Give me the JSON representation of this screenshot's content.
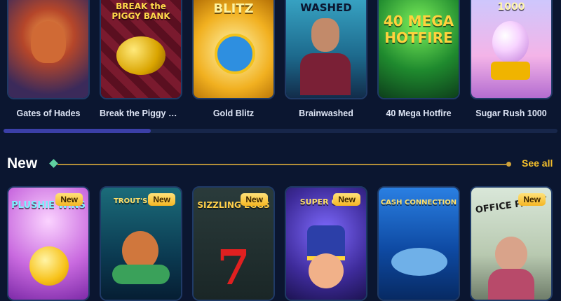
{
  "top_row": {
    "games": [
      {
        "label": "Gates of Hades",
        "art_text": ""
      },
      {
        "label": "Break the Piggy Ba...",
        "art_text": "BREAK the PIGGY BANK"
      },
      {
        "label": "Gold Blitz",
        "art_text": "BLITZ"
      },
      {
        "label": "Brainwashed",
        "art_text": "WASHED"
      },
      {
        "label": "40 Mega Hotfire",
        "art_text": "40 MEGA HOTFIRE"
      },
      {
        "label": "Sugar Rush 1000",
        "art_text": "1000"
      }
    ]
  },
  "new_section": {
    "title": "New",
    "see_all": "See all",
    "games": [
      {
        "badge": "New",
        "art_text": "PLUSHIE WINS"
      },
      {
        "badge": "New",
        "art_text": "TROUT'S TR..."
      },
      {
        "badge": "New",
        "art_text": "SIZZLING EGGS"
      },
      {
        "badge": "New",
        "art_text": "SUPER CH..."
      },
      {
        "badge": "",
        "art_text": "CASH CONNECTION"
      },
      {
        "badge": "New",
        "art_text": "OFFICE PARTY"
      }
    ]
  },
  "colors": {
    "background": "#0b1630",
    "accent_gold": "#f4bf2b",
    "scrollbar": "#3b3fa7"
  }
}
